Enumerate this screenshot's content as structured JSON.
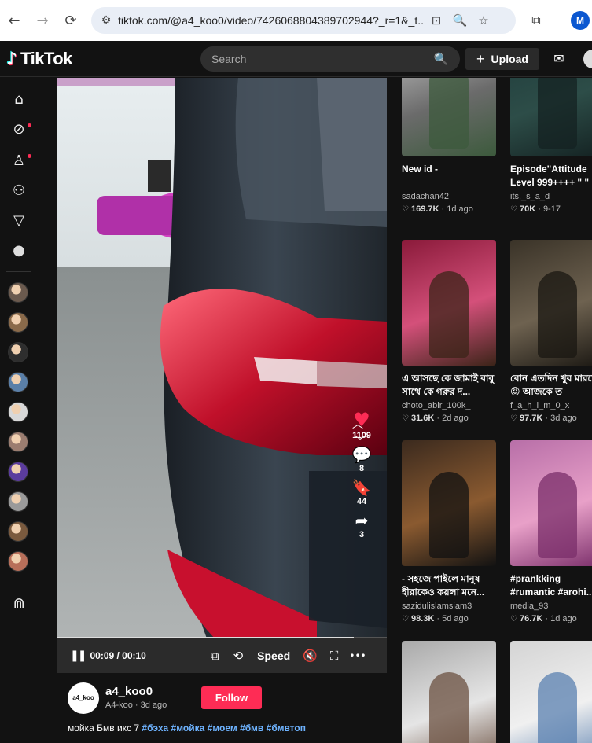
{
  "browser": {
    "url": "tiktok.com/@a4_koo0/video/7426068804389702944?_r=1&_t...",
    "profile_initial": "M",
    "back_icon": "←",
    "forward_icon": "→",
    "reload_icon": "⟳",
    "site_settings_icon": "⚙",
    "install_icon": "⊡",
    "zoom_icon": "🔍",
    "star_icon": "☆",
    "extensions_icon": "⧉"
  },
  "header": {
    "logo_note": "♪",
    "logo_text": "TikTok",
    "search_placeholder": "Search",
    "search_icon": "🔍",
    "upload_plus": "+",
    "upload_label": "Upload",
    "inbox_icon": "✉"
  },
  "rail": {
    "icons": [
      {
        "name": "home-icon",
        "glyph": "⌂"
      },
      {
        "name": "explore-icon",
        "glyph": "⊘"
      },
      {
        "name": "following-icon",
        "glyph": "♙"
      },
      {
        "name": "friends-icon",
        "glyph": "⚇"
      },
      {
        "name": "live-icon",
        "glyph": "▽"
      },
      {
        "name": "profile-icon",
        "glyph": "●"
      }
    ],
    "avatar_colors": [
      "#6b5a4e",
      "#8a6a4a",
      "#2e2e2e",
      "#5a7fa8",
      "#d8d8d8",
      "#9b7d70",
      "#5b3c9e",
      "#9a9a9a",
      "#7a5a3e",
      "#b86f5a"
    ],
    "bottom_icon": "⋒"
  },
  "video": {
    "time": "00:09 / 00:10",
    "progress_fraction": 0.9,
    "speed_label": "Speed",
    "pause_icon": "❚❚",
    "pip_icon": "⧉",
    "flip_icon": "⟲",
    "mute_icon": "🔇",
    "fullscreen_icon": "⛶",
    "more_icon": "•••",
    "up_icon": "︿",
    "down_icon": "﹀",
    "like_icon": "♥",
    "likes": "1109",
    "comment_icon": "💬",
    "comments": "8",
    "save_icon": "🔖",
    "saves": "44",
    "share_icon": "➦",
    "shares": "3"
  },
  "author": {
    "avatar_text": "a4_koo",
    "username": "a4_koo0",
    "subline": "A4-koo · 3d ago",
    "follow_label": "Follow",
    "caption_text": "мойка Бмв икс 7 ",
    "hashtags": [
      "#бэха",
      "#мойка",
      "#моем",
      "#бмв",
      "#бмвтоп"
    ]
  },
  "cards": [
    {
      "title": "New id -",
      "author": "sadachan42",
      "likes": "169.7K",
      "age": "1d ago",
      "colors": [
        "#c9c9c9",
        "#6b6b6b",
        "#3c5a3c"
      ]
    },
    {
      "title": "Episode\"Attitude Level 999++++ \" \"",
      "author": "its._s_a_d",
      "likes": "70K",
      "age": "9-17",
      "colors": [
        "#1e3a3a",
        "#2d4d48",
        "#142222"
      ]
    },
    {
      "title": "এ আসছে কে জামাই বাবু সাথে কে গরুর দ...",
      "author": "choto_abir_100k_",
      "likes": "31.6K",
      "age": "2d ago",
      "colors": [
        "#8a1a3a",
        "#d4507a",
        "#3b2418"
      ]
    },
    {
      "title": "বোন এতদিন খুব মারছো😡 আজকে ত",
      "author": "f_a_h_i_m_0_x",
      "likes": "97.7K",
      "age": "3d ago",
      "colors": [
        "#3a3328",
        "#6e6250",
        "#1a1712"
      ]
    },
    {
      "title": "- সহজে পাইলে মানুষ হীরাকেও কয়লা মনে...",
      "author": "sazidulislamsiam3",
      "likes": "98.3K",
      "age": "5d ago",
      "colors": [
        "#3b2a1e",
        "#8a5a30",
        "#121212"
      ]
    },
    {
      "title": "#prankking #rumantic #arohi...",
      "author": "media_93",
      "likes": "76.7K",
      "age": "1d ago",
      "colors": [
        "#b86fa8",
        "#e8a0c8",
        "#7a2e6a"
      ]
    },
    {
      "title": "",
      "author": "",
      "likes": "",
      "age": "",
      "colors": [
        "#a9a9a9",
        "#e5e5e5",
        "#6b5040"
      ]
    },
    {
      "title": "",
      "author": "",
      "likes": "",
      "age": "",
      "colors": [
        "#d4d4d4",
        "#f0f0f0",
        "#5a80b0"
      ]
    }
  ],
  "like_heart": "♡"
}
